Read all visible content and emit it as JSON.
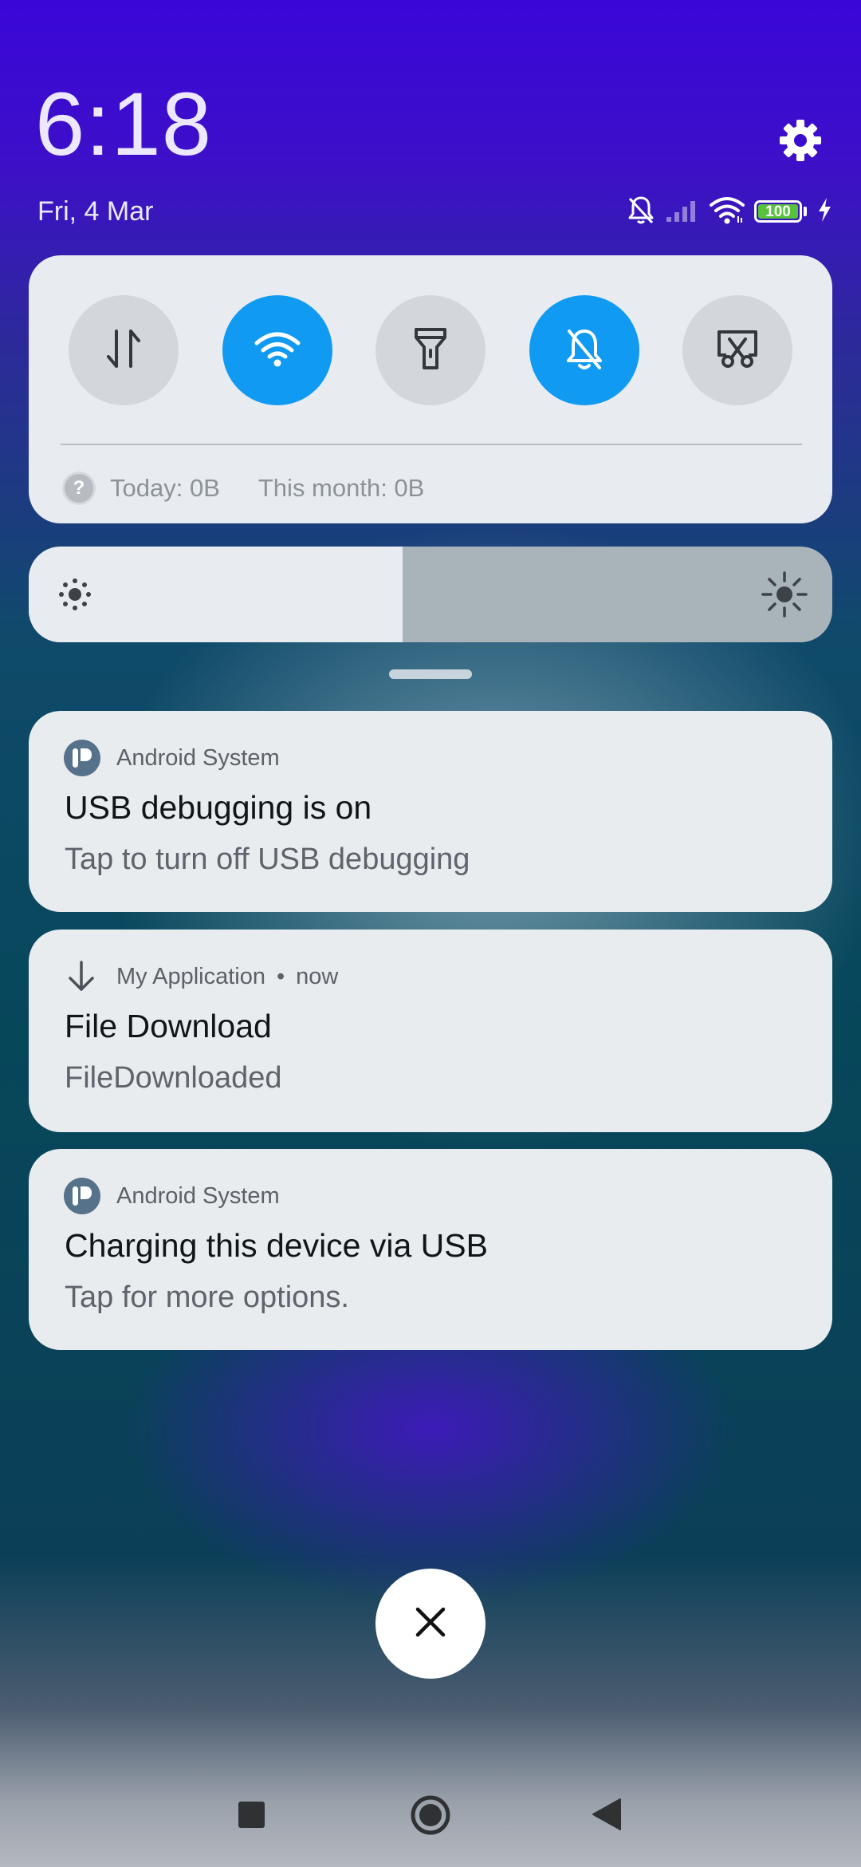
{
  "header": {
    "time": "6:18",
    "date": "Fri, 4 Mar",
    "settings_icon": "gear-icon",
    "status_icons": [
      "bell-muted-icon",
      "signal-icon",
      "wifi-icon",
      "battery-icon",
      "charging-bolt-icon"
    ],
    "battery_level": "100"
  },
  "quick_settings": {
    "toggles": [
      {
        "name": "mobile-data",
        "icon": "data-arrows-icon",
        "on": false
      },
      {
        "name": "wifi",
        "icon": "wifi-icon",
        "on": true
      },
      {
        "name": "flashlight",
        "icon": "flashlight-icon",
        "on": false
      },
      {
        "name": "silent",
        "icon": "bell-muted-icon",
        "on": true
      },
      {
        "name": "screenshot",
        "icon": "screenshot-icon",
        "on": false
      }
    ],
    "usage": {
      "today": "Today: 0B",
      "month": "This month: 0B"
    },
    "colors": {
      "toggle_on": "#109af2",
      "toggle_off": "#d3d7dc"
    }
  },
  "brightness": {
    "level": 0.465
  },
  "notifications": [
    {
      "app": "Android System",
      "title": "USB debugging is on",
      "text": "Tap to turn off USB debugging"
    },
    {
      "app": "My Application",
      "separator": "•",
      "time": "now",
      "title": "File Download",
      "text": "FileDownloaded"
    },
    {
      "app": "Android System",
      "title": "Charging this device via USB",
      "text": "Tap for more options."
    }
  ],
  "nav": {
    "buttons": [
      "recents-icon",
      "home-icon",
      "back-icon"
    ]
  }
}
